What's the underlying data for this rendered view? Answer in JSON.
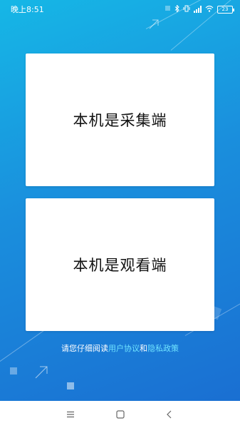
{
  "status_bar": {
    "time": "晚上8:51",
    "battery": "23",
    "icons": [
      "bluetooth-icon",
      "vibrate-icon",
      "signal-icon",
      "wifi-icon",
      "battery-icon"
    ]
  },
  "cards": {
    "collect_label": "本机是采集端",
    "watch_label": "本机是观看端"
  },
  "agreement": {
    "prefix": "请您仔细阅读",
    "user_agreement": "用户协议",
    "and": "和",
    "privacy_policy": "隐私政策"
  },
  "nav_bar": {
    "icons": [
      "menu-icon",
      "home-icon",
      "back-icon"
    ]
  },
  "colors": {
    "background_top": "#16b7e6",
    "background_bottom": "#1a6fd2",
    "link": "#6fe3ff"
  }
}
